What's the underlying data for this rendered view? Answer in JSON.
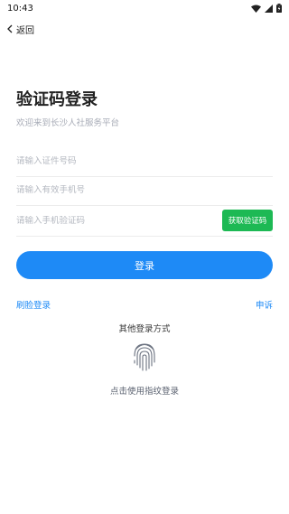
{
  "status_bar": {
    "time": "10:43"
  },
  "nav": {
    "back_label": "返回"
  },
  "header": {
    "title": "验证码登录",
    "subtitle": "欢迎来到长沙人社服务平台"
  },
  "form": {
    "id_placeholder": "请输入证件号码",
    "phone_placeholder": "请输入有效手机号",
    "code_placeholder": "请输入手机验证码",
    "get_code_label": "获取验证码",
    "submit_label": "登录"
  },
  "links": {
    "face_login": "刷脸登录",
    "complaint": "申诉"
  },
  "other": {
    "title": "其他登录方式",
    "fingerprint_label": "点击使用指纹登录"
  },
  "colors": {
    "primary": "#1e8af6",
    "code_button": "#1db954"
  }
}
